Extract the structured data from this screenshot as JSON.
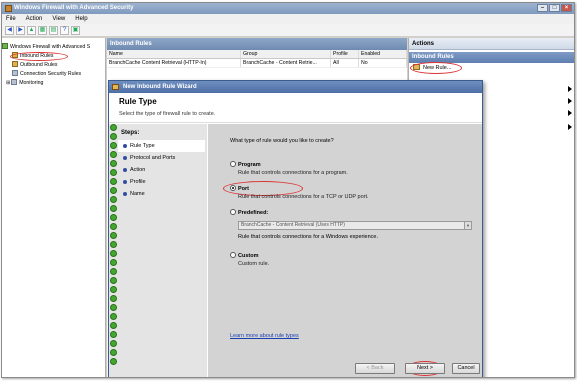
{
  "window": {
    "title": "Windows Firewall with Advanced Security"
  },
  "menu": [
    "File",
    "Action",
    "View",
    "Help"
  ],
  "tree": {
    "root": "Windows Firewall with Advanced S",
    "items": [
      "Inbound Rules",
      "Outbound Rules",
      "Connection Security Rules",
      "Monitoring"
    ]
  },
  "list": {
    "title": "Inbound Rules",
    "columns": [
      "Name",
      "Group",
      "Profile",
      "Enabled"
    ],
    "row": [
      "BranchCache Content Retrieval (HTTP-In)",
      "BranchCache - Content Retrie...",
      "All",
      "No"
    ]
  },
  "actions": {
    "title": "Actions",
    "section": "Inbound Rules",
    "new_rule": "New Rule..."
  },
  "dialog": {
    "title": "New Inbound Rule Wizard",
    "heading": "Rule Type",
    "subtitle": "Select the type of firewall rule to create.",
    "steps_title": "Steps:",
    "steps": [
      "Rule Type",
      "Protocol and Ports",
      "Action",
      "Profile",
      "Name"
    ],
    "question": "What type of rule would you like to create?",
    "options": [
      {
        "label": "Program",
        "desc": "Rule that controls connections for a program.",
        "selected": false
      },
      {
        "label": "Port",
        "desc": "Rule that controls connections for a TCP or UDP port.",
        "selected": true
      },
      {
        "label": "Predefined:",
        "desc": "Rule that controls connections for a Windows experience.",
        "selected": false
      },
      {
        "label": "Custom",
        "desc": "Custom rule.",
        "selected": false
      }
    ],
    "predefined_value": "BranchCache - Content Retrieval (Uses HTTP)",
    "learn_link": "Learn more about rule types",
    "buttons": {
      "back": "< Back",
      "next": "Next >",
      "cancel": "Cancel"
    }
  }
}
